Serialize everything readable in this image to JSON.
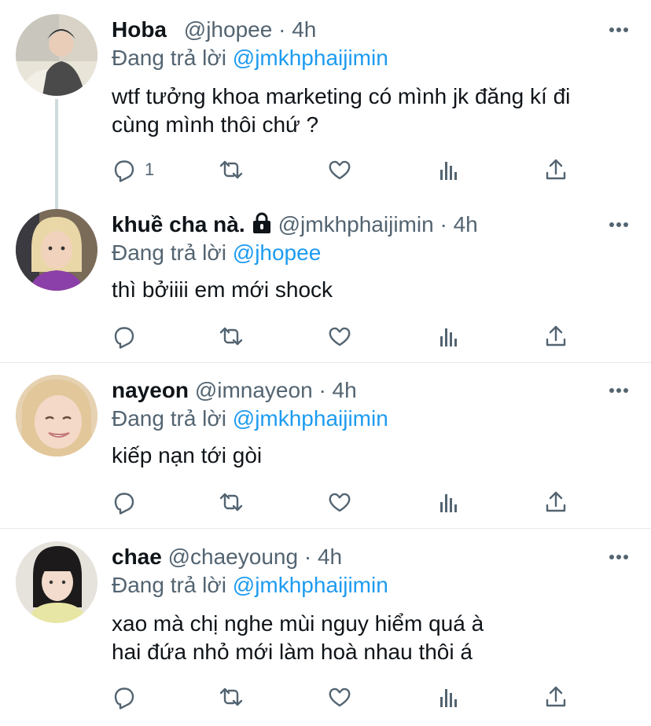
{
  "replying_label": "Đang trả lời",
  "tweets": [
    {
      "name": "Hoba",
      "handle": "@jhopee",
      "time": "4h",
      "reply_to": "@jmkhphaijimin",
      "text_lines": [
        "wtf tưởng khoa marketing có mình jk đăng kí đi",
        "cùng mình thôi chứ ?"
      ],
      "reply_count": "1",
      "avatar_icon": "avatar-photo"
    },
    {
      "name": "khuề cha nà.",
      "handle": "@jmkhphaijimin",
      "time": "4h",
      "reply_to": "@jhopee",
      "text_lines": [
        "thì bởiiii em mới shock"
      ],
      "reply_count": "",
      "protected": true,
      "avatar_icon": "avatar-photo"
    },
    {
      "name": "nayeon",
      "handle": "@imnayeon",
      "time": "4h",
      "reply_to": "@jmkhphaijimin",
      "text_lines": [
        "kiếp nạn tới gòi"
      ],
      "reply_count": "",
      "avatar_icon": "avatar-photo"
    },
    {
      "name": "chae",
      "handle": "@chaeyoung",
      "time": "4h",
      "reply_to": "@jmkhphaijimin",
      "text_lines": [
        "xao mà chị nghe mùi nguy hiểm quá à",
        "hai đứa nhỏ mới làm hoà nhau thôi á"
      ],
      "reply_count": "",
      "avatar_icon": "avatar-photo"
    }
  ],
  "colors": {
    "accent": "#1d9bf0",
    "secondary_text": "#536471",
    "divider": "#e7e9ea"
  }
}
